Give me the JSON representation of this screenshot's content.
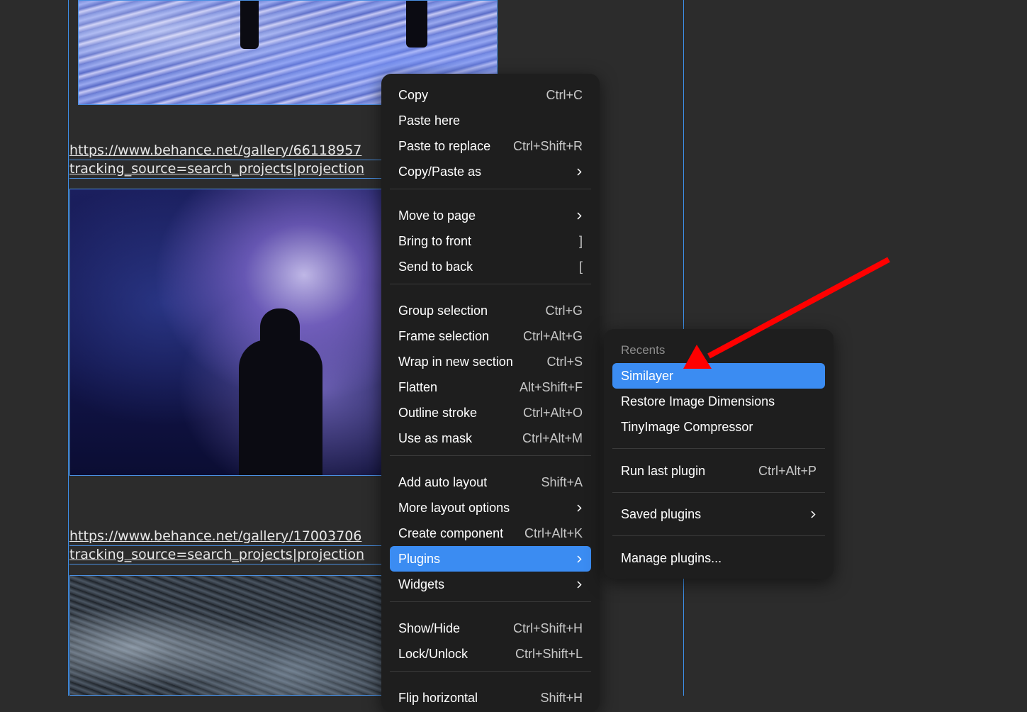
{
  "canvas": {
    "urls": [
      {
        "line1": "https://www.behance.net/gallery/66118957",
        "line2": "tracking_source=search_projects|projection"
      },
      {
        "line1": "https://www.behance.net/gallery/17003706",
        "line2": "tracking_source=search_projects|projection"
      }
    ]
  },
  "context_menu": {
    "groups": [
      [
        {
          "label": "Copy",
          "shortcut": "Ctrl+C"
        },
        {
          "label": "Paste here",
          "shortcut": ""
        },
        {
          "label": "Paste to replace",
          "shortcut": "Ctrl+Shift+R"
        },
        {
          "label": "Copy/Paste as",
          "submenu": true
        }
      ],
      [
        {
          "label": "Move to page",
          "submenu": true
        },
        {
          "label": "Bring to front",
          "shortcut": "]"
        },
        {
          "label": "Send to back",
          "shortcut": "["
        }
      ],
      [
        {
          "label": "Group selection",
          "shortcut": "Ctrl+G"
        },
        {
          "label": "Frame selection",
          "shortcut": "Ctrl+Alt+G"
        },
        {
          "label": "Wrap in new section",
          "shortcut": "Ctrl+S"
        },
        {
          "label": "Flatten",
          "shortcut": "Alt+Shift+F"
        },
        {
          "label": "Outline stroke",
          "shortcut": "Ctrl+Alt+O"
        },
        {
          "label": "Use as mask",
          "shortcut": "Ctrl+Alt+M"
        }
      ],
      [
        {
          "label": "Add auto layout",
          "shortcut": "Shift+A"
        },
        {
          "label": "More layout options",
          "submenu": true
        },
        {
          "label": "Create component",
          "shortcut": "Ctrl+Alt+K"
        },
        {
          "label": "Plugins",
          "submenu": true,
          "active": true
        },
        {
          "label": "Widgets",
          "submenu": true
        }
      ],
      [
        {
          "label": "Show/Hide",
          "shortcut": "Ctrl+Shift+H"
        },
        {
          "label": "Lock/Unlock",
          "shortcut": "Ctrl+Shift+L"
        }
      ],
      [
        {
          "label": "Flip horizontal",
          "shortcut": "Shift+H"
        }
      ]
    ]
  },
  "plugins_submenu": {
    "recents_label": "Recents",
    "recents": [
      {
        "label": "Similayer",
        "active": true
      },
      {
        "label": "Restore Image Dimensions"
      },
      {
        "label": "TinyImage Compressor"
      }
    ],
    "run_last": {
      "label": "Run last plugin",
      "shortcut": "Ctrl+Alt+P"
    },
    "saved": {
      "label": "Saved plugins"
    },
    "manage": {
      "label": "Manage plugins..."
    }
  },
  "colors": {
    "canvas_bg": "#2c2c2c",
    "menu_bg": "#1e1e1e",
    "highlight": "#3b8cf2",
    "selection": "#3d8fe8",
    "annotation_arrow": "#ff0000"
  }
}
